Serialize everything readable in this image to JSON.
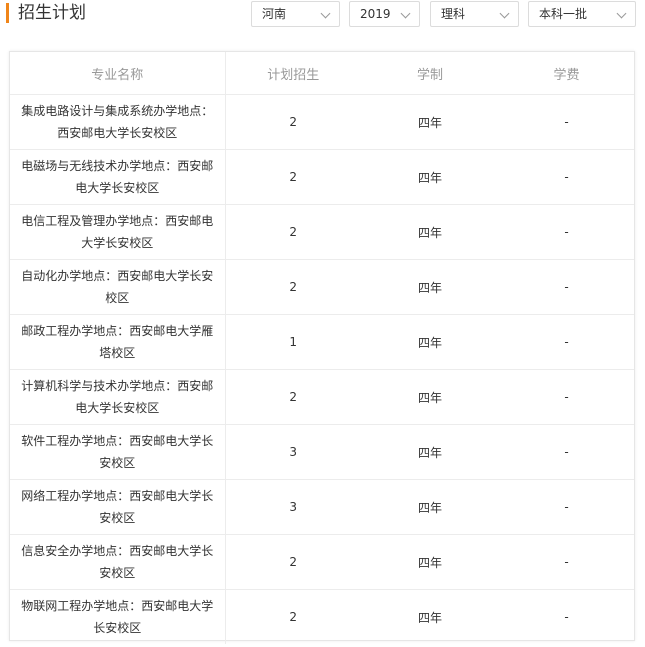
{
  "page_title": "招生计划",
  "filters": {
    "province": "河南",
    "year": "2019",
    "subject": "理科",
    "batch": "本科一批"
  },
  "table": {
    "headers": [
      "专业名称",
      "计划招生",
      "学制",
      "学费"
    ],
    "rows": [
      {
        "name": "集成电路设计与集成系统办学地点：西安邮电大学长安校区",
        "plan": "2",
        "duration": "四年",
        "fee": "-"
      },
      {
        "name": "电磁场与无线技术办学地点：西安邮电大学长安校区",
        "plan": "2",
        "duration": "四年",
        "fee": "-"
      },
      {
        "name": "电信工程及管理办学地点：西安邮电大学长安校区",
        "plan": "2",
        "duration": "四年",
        "fee": "-"
      },
      {
        "name": "自动化办学地点：西安邮电大学长安校区",
        "plan": "2",
        "duration": "四年",
        "fee": "-"
      },
      {
        "name": "邮政工程办学地点：西安邮电大学雁塔校区",
        "plan": "1",
        "duration": "四年",
        "fee": "-"
      },
      {
        "name": "计算机科学与技术办学地点：西安邮电大学长安校区",
        "plan": "2",
        "duration": "四年",
        "fee": "-"
      },
      {
        "name": "软件工程办学地点：西安邮电大学长安校区",
        "plan": "3",
        "duration": "四年",
        "fee": "-"
      },
      {
        "name": "网络工程办学地点：西安邮电大学长安校区",
        "plan": "3",
        "duration": "四年",
        "fee": "-"
      },
      {
        "name": "信息安全办学地点：西安邮电大学长安校区",
        "plan": "2",
        "duration": "四年",
        "fee": "-"
      },
      {
        "name": "物联网工程办学地点：西安邮电大学长安校区",
        "plan": "2",
        "duration": "四年",
        "fee": "-"
      }
    ]
  }
}
